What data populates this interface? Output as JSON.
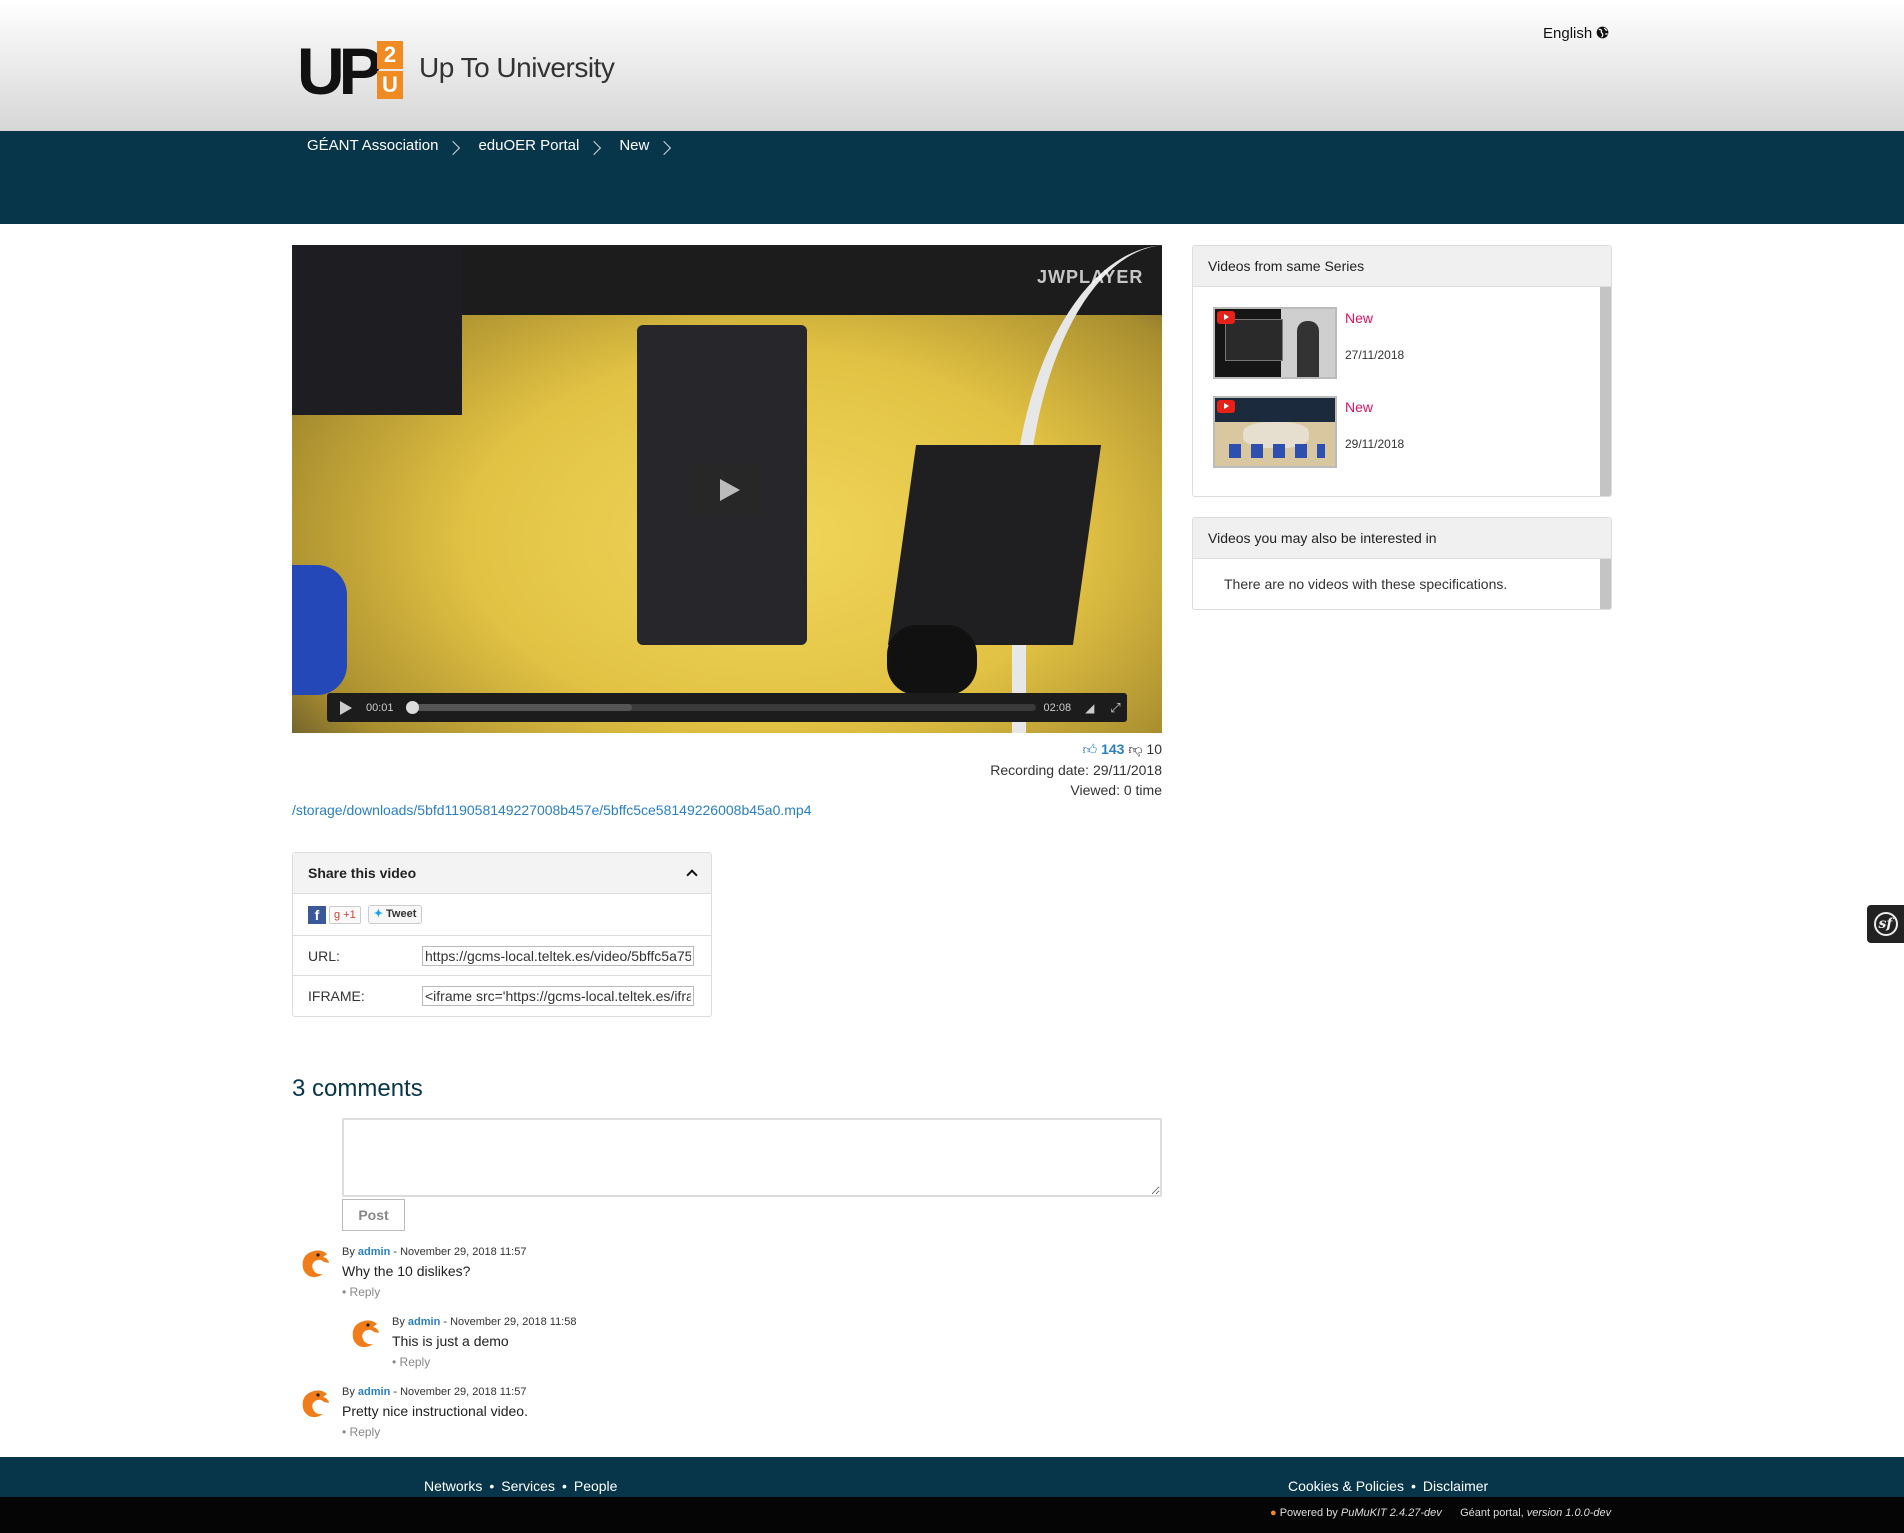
{
  "header": {
    "logo": {
      "up": "UP",
      "two": "2",
      "u": "U"
    },
    "site_title": "Up To University",
    "language": "English",
    "language_icon": "globe-icon"
  },
  "breadcrumbs": [
    "GÉANT Association",
    "eduOER Portal",
    "New"
  ],
  "player": {
    "watermark": "JWPLAYER",
    "current_time": "00:01",
    "duration": "02:08",
    "progress_fraction": 0.01,
    "buffered_fraction": 0.36
  },
  "video_meta": {
    "likes": "143",
    "dislikes": "10",
    "recording_date": "Recording date: 29/11/2018",
    "viewed": "Viewed: 0 time",
    "download_link": "/storage/downloads/5bfd119058149227008b457e/5bffc5ce58149226008b45a0.mp4"
  },
  "share": {
    "title": "Share this video",
    "facebook_label": "f",
    "gplus_label": "g +1",
    "tweet_label": "Tweet",
    "url_label": "URL:",
    "url_value": "https://gcms-local.teltek.es/video/5bffc5a75",
    "iframe_label": "IFRAME:",
    "iframe_value": "<iframe src='https://gcms-local.teltek.es/ifra"
  },
  "comments": {
    "title": "3 comments",
    "post_label": "Post",
    "items": [
      {
        "by": "By",
        "author": "admin",
        "date": "- November 29, 2018 11:57",
        "text": "Why the 10 dislikes?",
        "reply": "• Reply"
      },
      {
        "by": "By",
        "author": "admin",
        "date": "- November 29, 2018 11:58",
        "text": "This is just a demo",
        "reply": "• Reply"
      },
      {
        "by": "By",
        "author": "admin",
        "date": "- November 29, 2018 11:57",
        "text": "Pretty nice instructional video.",
        "reply": "• Reply"
      }
    ]
  },
  "sidebar": {
    "series_title": "Videos from same Series",
    "series": [
      {
        "title": "New",
        "date": "27/11/2018"
      },
      {
        "title": "New",
        "date": "29/11/2018"
      }
    ],
    "related_title": "Videos you may also be interested in",
    "related_empty": "There are no videos with these specifications."
  },
  "side_tab_label": "sf",
  "footer": {
    "left_links": [
      "Networks",
      "•",
      "Services",
      "•",
      "People"
    ],
    "right_links": [
      "Cookies & Policies",
      "•",
      "Disclaimer"
    ],
    "powered_prefix": "Powered by",
    "powered_name": "PuMuKIT 2.4.27-dev",
    "portal_prefix": "Géant portal,",
    "portal_version": "version 1.0.0-dev"
  },
  "colors": {
    "navy": "#073549",
    "link_blue": "#2a7fc4",
    "series_pink": "#e0115f",
    "logo_orange": "#f08a22"
  }
}
